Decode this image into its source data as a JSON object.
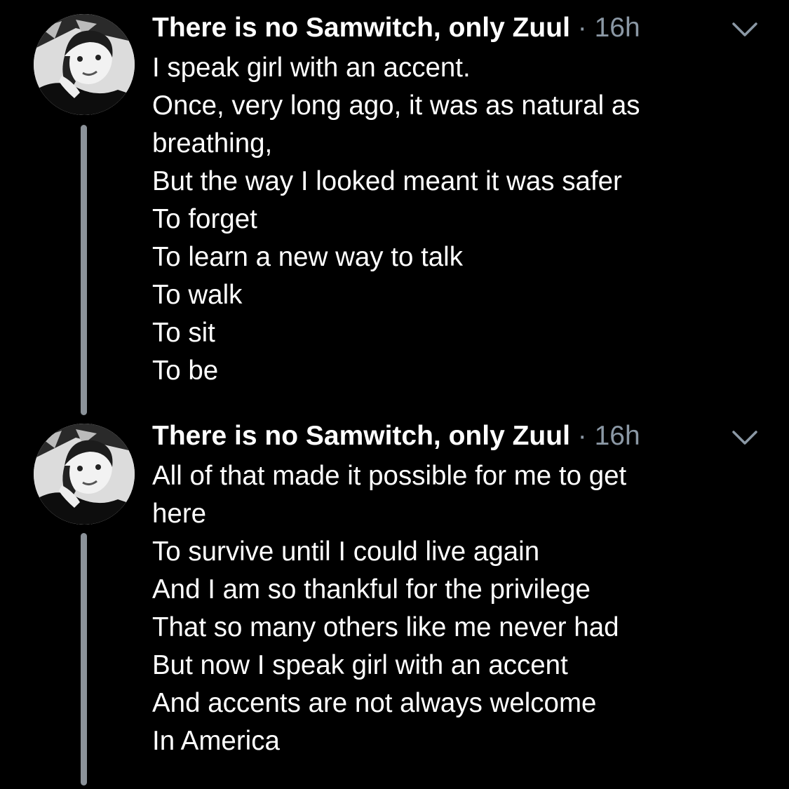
{
  "colors": {
    "background": "#000000",
    "text": "#ffffff",
    "meta": "#8b98a5",
    "thread_line": "#8b9299"
  },
  "tweets": [
    {
      "display_name": "There is no Samwitch, only Zuul",
      "separator": "·",
      "time": "16h",
      "menu_icon": "chevron-down-icon",
      "lines": [
        "I speak girl with an accent.",
        "Once, very long ago, it was as natural as",
        "breathing,",
        "But the way I looked meant it was safer",
        "To forget",
        "To learn a new way to talk",
        "To walk",
        "To sit",
        "To be"
      ]
    },
    {
      "display_name": "There is no Samwitch, only Zuul",
      "separator": "·",
      "time": "16h",
      "menu_icon": "chevron-down-icon",
      "lines": [
        "All of that made it possible for me to get",
        "here",
        "To survive until I could live again",
        "And I am so thankful for the privilege",
        "That so many others like me never had",
        "But now I speak girl with an accent",
        "And accents are not always welcome",
        "In America"
      ]
    }
  ]
}
